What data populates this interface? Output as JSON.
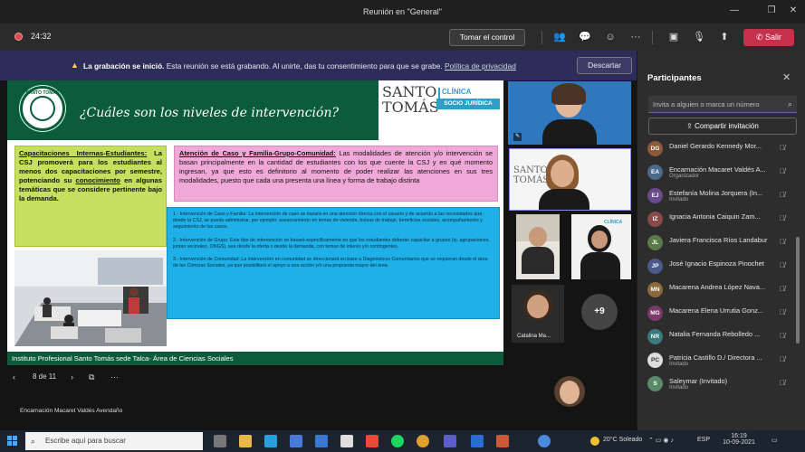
{
  "window": {
    "title": "Reunión en \"General\""
  },
  "toolbar": {
    "timer": "24:32",
    "take_control": "Tomar el control",
    "leave": "Salir"
  },
  "banner": {
    "bold": "La grabación se inició.",
    "text": "Esta reunión se está grabando. Al unirte, das tu consentimiento para que se grabe.",
    "link": "Política de privacidad",
    "dismiss": "Descartar"
  },
  "slide": {
    "title": "¿Cuáles son los niveles de intervención?",
    "logo_main": "SANTO TOMÁS",
    "logo_clinic": "CLÍNICA",
    "logo_socio": "SOCIO JURÍDICA",
    "green_heading": "Capacitaciones Internas-Estudiantes:",
    "green_text_1": "La CSJ promoverá para los estudiantes al menos dos capacitaciones por semestre, potenciando su",
    "green_bold": "conocimiento",
    "green_text_2": "en algunas temáticas que se considere pertinente bajo la demanda.",
    "pink_heading": "Atención de Caso y Familia-Grupo-Comunidad:",
    "pink_text": "Las modalidades de atención y/o intervención se basan principalmente en la cantidad de estudiantes con los que cuente la CSJ y en qué momento ingresan, ya que esto es definitorio al momento de poder realizar las atenciones en sus tres modalidades, puesto que cada una presenta una línea y forma de trabajo distinta",
    "blue_p1": "1.- Intervención de Caso y Familia: La intervención de caso se basará en una atención directa con el usuario y de acuerdo a las necesidades que, desde la CSJ, se pueda administrar, por ejemplo: asesoramiento en temas de vivienda, bolsas de trabajo, beneficios sociales, acompañamiento y seguimiento de los casos.",
    "blue_p2": "2.- Intervención de Grupo: Este tipo de intervención se basará específicamente en que los estudiantes deberán capacitar a grupos (ej. agrupaciones, juntas vecinales, ONGS), sea desde la oferta o desde la demanda, con temas de interés y/o contingentes.",
    "blue_p3": "3.- Intervención de Comunidad: La intervención en comunidad se direccionará en base a Diagnósticos Comunitarios que se requieran desde el área de las Ciencias Sociales, ya que posibilitará el apoyo a una acción y/o una propuesta mayor del área.",
    "footer": "Instituto Profesional Santo Tomás sede Talca- Área de Ciencias Sociales"
  },
  "controls": {
    "page": "8 de 11"
  },
  "presenter": "Encarnación Macaret Valdés Avendaño",
  "tiles": {
    "catalina": "Catalina Ma...",
    "overflow": "+9"
  },
  "panel": {
    "title": "Participantes",
    "invite_placeholder": "Invita a alguien o marca un número",
    "share": "Compartir invitación",
    "people": [
      {
        "name": "Daniel Gerardo Kennedy Mor...",
        "role": "",
        "initials": "DG",
        "color": "#8a5a3c"
      },
      {
        "name": "Encarnación Macaret Valdés A...",
        "role": "Organizador",
        "initials": "EA",
        "color": "#4a6a8a"
      },
      {
        "name": "Estefanía Molina Jorquera (In...",
        "role": "Invitado",
        "initials": "EJ",
        "color": "#6a4a8a"
      },
      {
        "name": "Ignacia Antonia Caiquin Zam...",
        "role": "",
        "initials": "IZ",
        "color": "#8a4a4a"
      },
      {
        "name": "Javiera Francisca Ríos Landabur",
        "role": "",
        "initials": "JL",
        "color": "#5a7a4a"
      },
      {
        "name": "José Ignacio Espinoza Pinochet",
        "role": "",
        "initials": "JP",
        "color": "#4a5a8a"
      },
      {
        "name": "Macarena Andrea López Nava...",
        "role": "",
        "initials": "MN",
        "color": "#8a6a3a"
      },
      {
        "name": "Macarena Elena Urrutia Gonz...",
        "role": "",
        "initials": "MG",
        "color": "#7a3a6a"
      },
      {
        "name": "Natalia Fernanda Rebolledo ...",
        "role": "",
        "initials": "NR",
        "color": "#3a7a7a"
      },
      {
        "name": "Patricia Castillo D./ Directora ...",
        "role": "Invitado",
        "initials": "PC",
        "color": "#ddd"
      },
      {
        "name": "Saleymar (Invitado)",
        "role": "Invitado",
        "initials": "S",
        "color": "#5a8a6a"
      }
    ]
  },
  "taskbar": {
    "search_placeholder": "Escribe aquí para buscar",
    "weather": "20°C Soleado",
    "lang": "ESP",
    "time": "16:19",
    "date": "10-09-2021"
  }
}
